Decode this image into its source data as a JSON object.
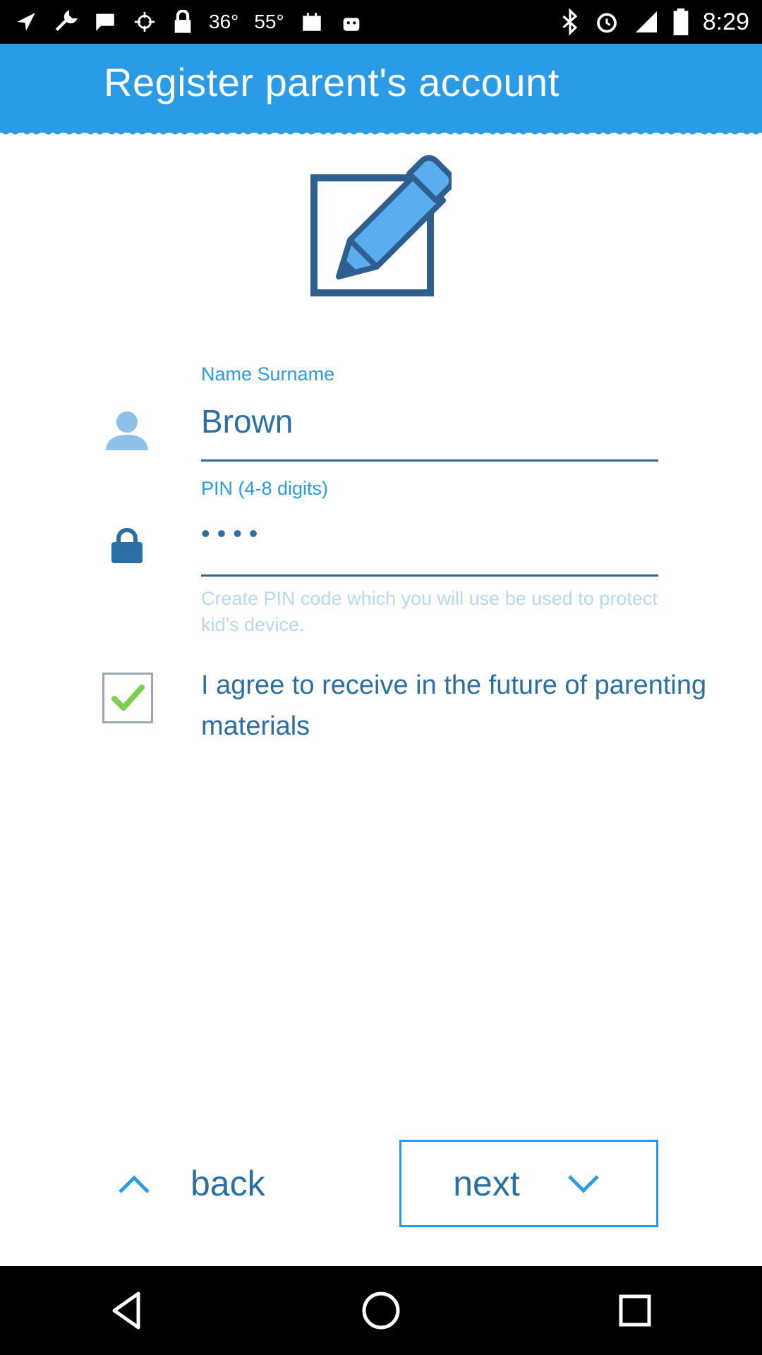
{
  "status_bar": {
    "temp1": "36°",
    "temp2": "55°",
    "time": "8:29"
  },
  "header": {
    "title": "Register parent's account"
  },
  "form": {
    "name": {
      "label": "Name Surname",
      "value": "Brown"
    },
    "pin": {
      "label": "PIN (4-8 digits)",
      "value": "••••",
      "helper": "Create PIN code which you will use be used to protect kid’s device."
    },
    "agree": {
      "checked": true,
      "label": "I agree to receive in the future of parenting materials"
    }
  },
  "buttons": {
    "back_label": "back",
    "next_label": "next"
  },
  "colors": {
    "accent": "#2a9be6",
    "text_dark_blue": "#2a6fa5",
    "helper_light_blue": "#b9d8ef"
  }
}
